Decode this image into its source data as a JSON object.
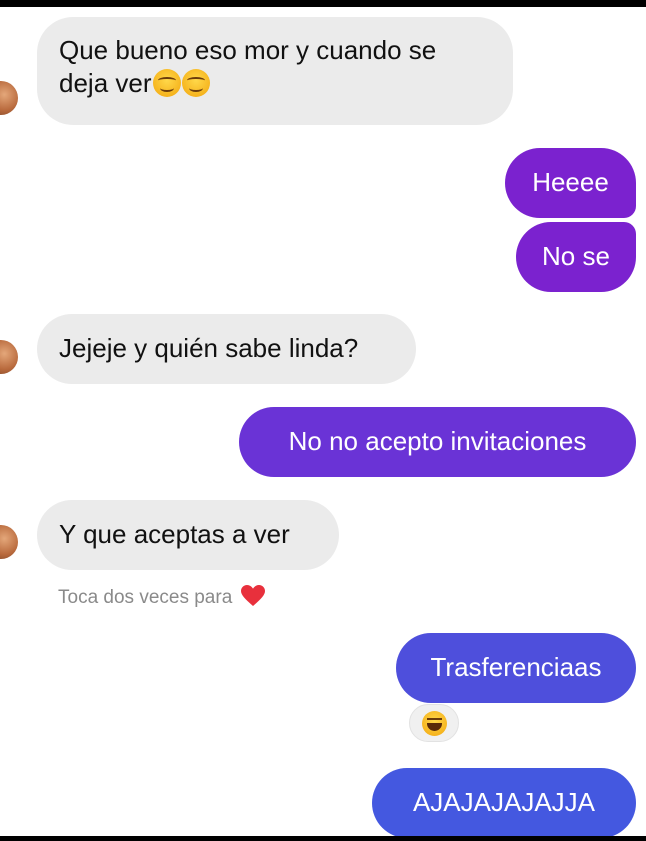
{
  "conversation": {
    "messages": [
      {
        "from": "them",
        "lines": [
          "Que bueno eso mor y cuando se",
          "deja ver"
        ],
        "emoji": [
          "smiling-face-icon",
          "smiling-face-icon"
        ]
      },
      {
        "from": "me",
        "text": "Heeee"
      },
      {
        "from": "me",
        "text": "No se"
      },
      {
        "from": "them",
        "text": "Jejeje y quién sabe linda?"
      },
      {
        "from": "me",
        "text": "No no acepto  invitaciones"
      },
      {
        "from": "them",
        "text": "Y que aceptas a ver"
      },
      {
        "from": "me",
        "text": "Trasferenciaas",
        "reaction": "laughing-face-icon"
      },
      {
        "from": "me",
        "text": "AJAJAJAJAJJA"
      }
    ],
    "hint": {
      "text": "Toca dos veces para",
      "icon": "heart-icon",
      "icon_color": "#e8303c"
    }
  },
  "colors": {
    "incoming_bubble": "#ebebeb",
    "outgoing_purple": "#7b22cf",
    "outgoing_violet": "#6a33d6",
    "outgoing_indigo": "#4e4fdc",
    "outgoing_blue": "#4458e0"
  }
}
